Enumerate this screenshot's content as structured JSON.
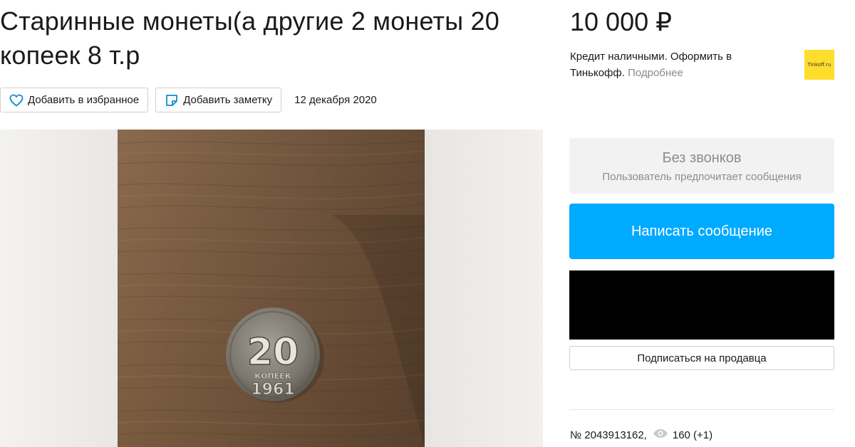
{
  "listing": {
    "title": "Старинные монеты(а другие 2 монеты 20 копеек 8 т.р",
    "add_favorite_label": "Добавить в избранное",
    "add_note_label": "Добавить заметку",
    "date": "12 декабря 2020"
  },
  "photo": {
    "coin_value": "20",
    "coin_word": "КОПЕЕК",
    "coin_year": "1961"
  },
  "sidebar": {
    "price": "10 000 ₽",
    "credit_text": "Кредит наличными. Оформить в Тинькофф.",
    "credit_more": "Подробнее",
    "tinkoff_logo_text": "Tinkoff.ru",
    "no_calls_title": "Без звонков",
    "no_calls_subtitle": "Пользователь предпочитает сообщения",
    "write_message_label": "Написать сообщение",
    "subscribe_label": "Подписаться на продавца",
    "listing_number": "№ 2043913162,",
    "views": "160 (+1)"
  },
  "colors": {
    "accent": "#00aaff",
    "price_text": "#1a1a1a",
    "muted": "#8c8c8c",
    "tinkoff_yellow": "#ffdd2d"
  },
  "icons": [
    "heart-icon",
    "note-icon",
    "eye-icon"
  ]
}
